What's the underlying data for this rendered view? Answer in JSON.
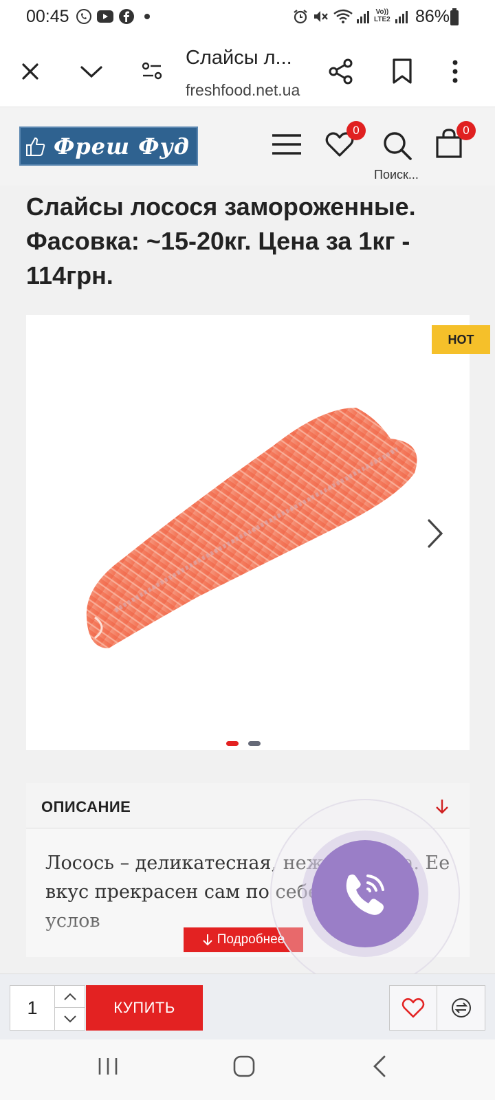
{
  "status_bar": {
    "time": "00:45",
    "battery": "86%"
  },
  "browser": {
    "page_title": "Слайсы л...",
    "url": "freshfood.net.ua"
  },
  "site_header": {
    "logo_text": "Фреш Фуд",
    "wishlist_count": "0",
    "cart_count": "0",
    "search_label": "Поиск..."
  },
  "product": {
    "title": "Слайсы лосося замороженные. Фасовка: ~15-20кг. Цена за 1кг - 114грн.",
    "badge": "HOT",
    "gallery_active_index": 1,
    "gallery_total": 2
  },
  "description": {
    "heading": "ОПИСАНИЕ",
    "text": "Лосось – деликатесная, нежная рыба. Ее вкус прекрасен сам по себе, поэтому услов",
    "more_label": "Подробнее"
  },
  "buy_bar": {
    "quantity": "1",
    "buy_label": "КУПИТЬ"
  },
  "colors": {
    "accent_red": "#e32222",
    "hot_badge": "#f5c02a",
    "logo_blue": "#2f6290",
    "viber_purple": "#9a7ec7"
  },
  "icons": {
    "status": [
      "viber-icon",
      "youtube-icon",
      "facebook-icon",
      "alarm-icon",
      "mute-icon",
      "wifi-icon",
      "signal-icon",
      "battery-icon"
    ],
    "browser": [
      "close-icon",
      "chevron-down-icon",
      "page-settings-icon",
      "share-icon",
      "bookmark-icon",
      "more-vert-icon"
    ],
    "header": [
      "menu-icon",
      "heart-icon",
      "search-icon",
      "cart-icon"
    ],
    "nav": [
      "recents-icon",
      "home-icon",
      "back-icon"
    ]
  }
}
